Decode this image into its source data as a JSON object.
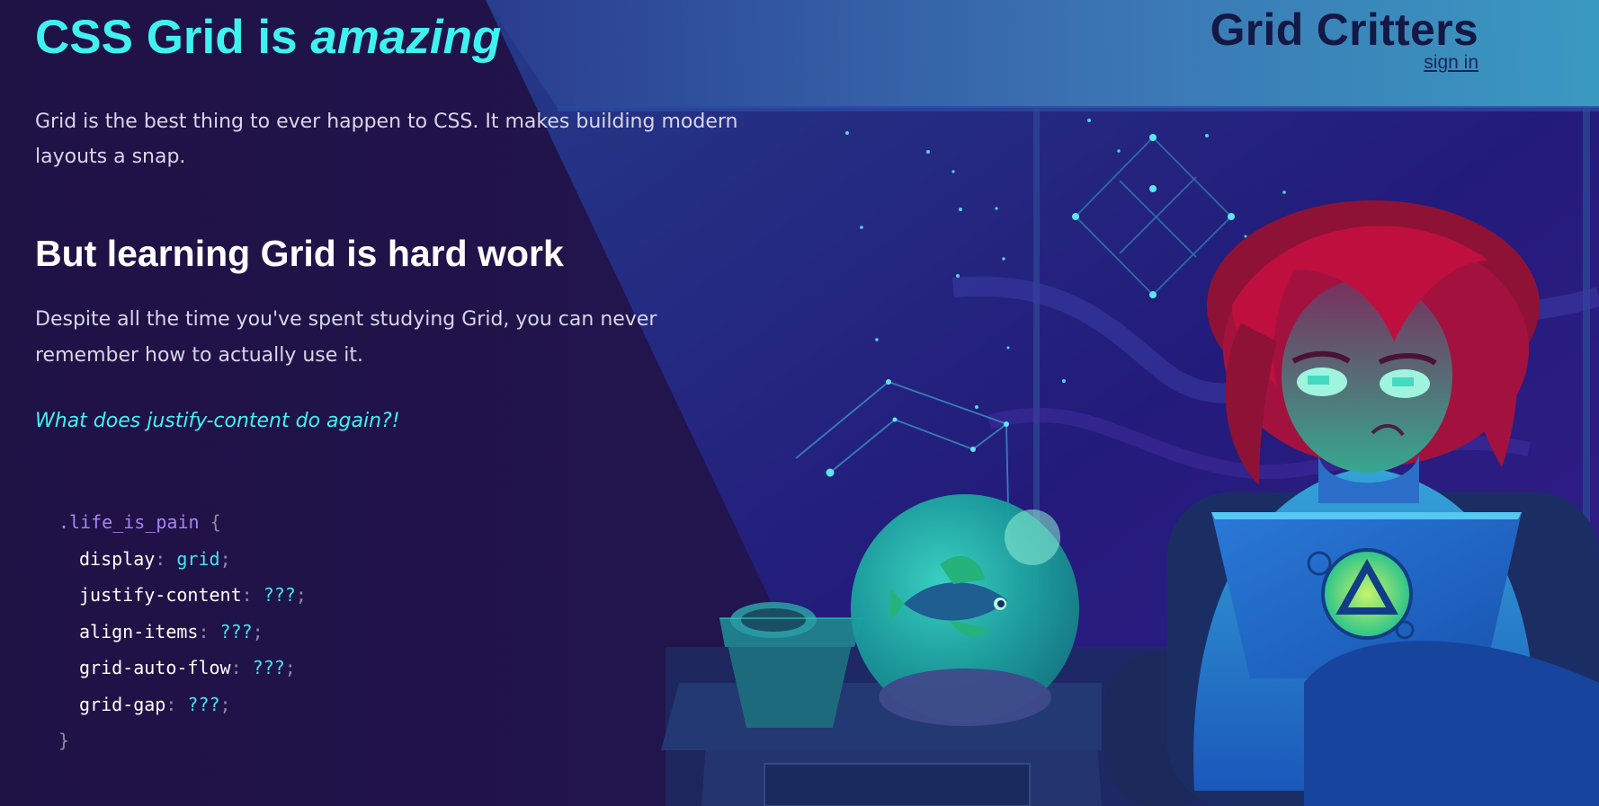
{
  "header": {
    "brand_title": "Grid Critters",
    "sign_in_label": "sign in"
  },
  "hero": {
    "title_prefix": "CSS Grid is ",
    "title_emphasis": "amazing",
    "lead": "Grid is the best thing to ever happen to CSS. It makes building modern layouts a snap."
  },
  "section": {
    "heading": "But learning Grid is hard work",
    "body": "Despite all the time you've spent studying Grid, you can never remember how to actually use it.",
    "quote": "What does justify-content do again?!"
  },
  "code": {
    "selector": ".life_is_pain",
    "open_brace": "{",
    "close_brace": "}",
    "declarations": [
      {
        "property": "display",
        "value": "grid"
      },
      {
        "property": "justify-content",
        "value": "???"
      },
      {
        "property": "align-items",
        "value": "???"
      },
      {
        "property": "grid-auto-flow",
        "value": "???"
      },
      {
        "property": "grid-gap",
        "value": "???"
      }
    ]
  },
  "illustration": {
    "icon": "developer-at-laptop-scene",
    "laptop_logo_icon": "triangle-logo-icon",
    "fishbowl_icon": "fishbowl-icon",
    "plant_pot_icon": "plant-pot-icon",
    "constellation_icon": "constellation-icon"
  },
  "colors": {
    "accent": "#3ff2f0",
    "background": "#1f1245",
    "heading": "#ffffff",
    "selector": "#a983f3",
    "banner": "#3f8fc0"
  }
}
